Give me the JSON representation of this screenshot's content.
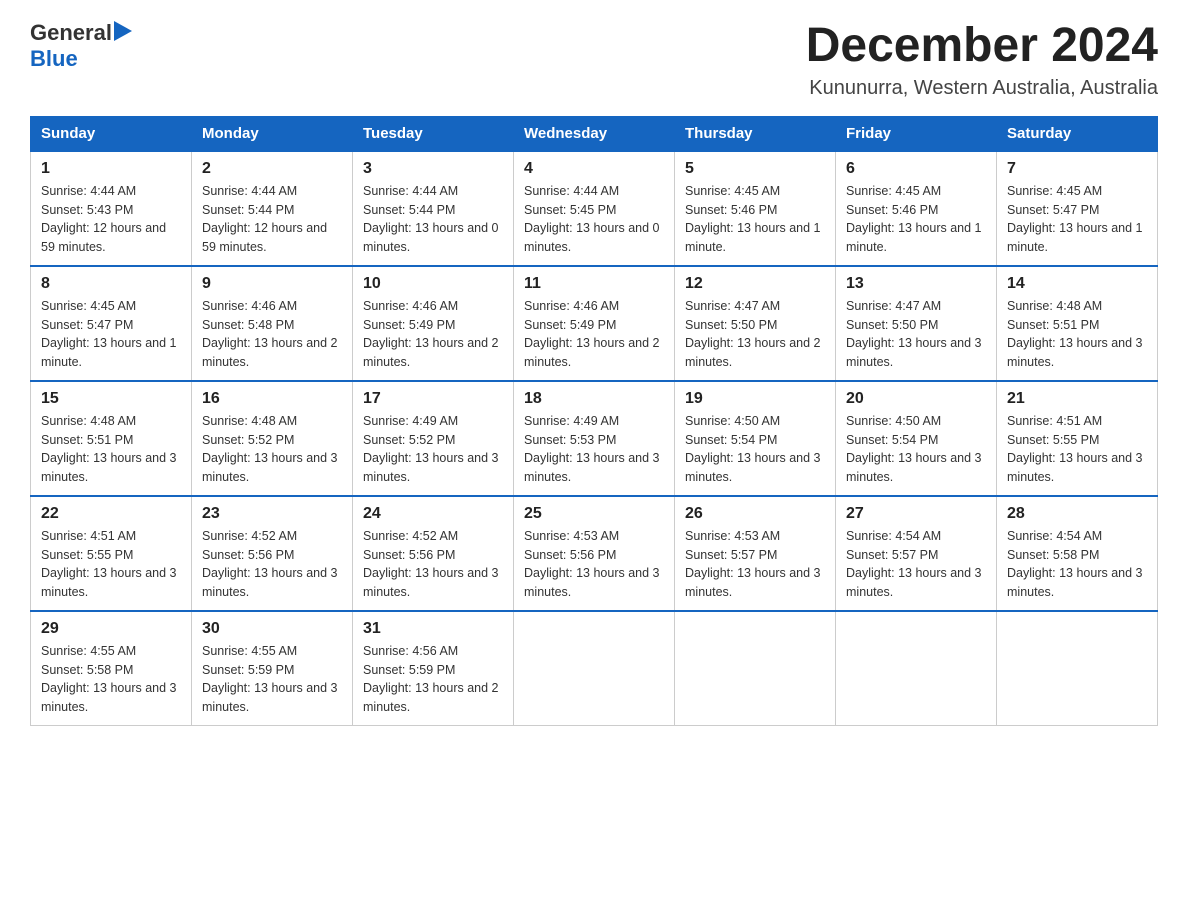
{
  "header": {
    "logo_general": "General",
    "logo_blue": "Blue",
    "month_title": "December 2024",
    "location": "Kununurra, Western Australia, Australia"
  },
  "days_of_week": [
    "Sunday",
    "Monday",
    "Tuesday",
    "Wednesday",
    "Thursday",
    "Friday",
    "Saturday"
  ],
  "weeks": [
    [
      {
        "day": "1",
        "sunrise": "4:44 AM",
        "sunset": "5:43 PM",
        "daylight": "12 hours and 59 minutes."
      },
      {
        "day": "2",
        "sunrise": "4:44 AM",
        "sunset": "5:44 PM",
        "daylight": "12 hours and 59 minutes."
      },
      {
        "day": "3",
        "sunrise": "4:44 AM",
        "sunset": "5:44 PM",
        "daylight": "13 hours and 0 minutes."
      },
      {
        "day": "4",
        "sunrise": "4:44 AM",
        "sunset": "5:45 PM",
        "daylight": "13 hours and 0 minutes."
      },
      {
        "day": "5",
        "sunrise": "4:45 AM",
        "sunset": "5:46 PM",
        "daylight": "13 hours and 1 minute."
      },
      {
        "day": "6",
        "sunrise": "4:45 AM",
        "sunset": "5:46 PM",
        "daylight": "13 hours and 1 minute."
      },
      {
        "day": "7",
        "sunrise": "4:45 AM",
        "sunset": "5:47 PM",
        "daylight": "13 hours and 1 minute."
      }
    ],
    [
      {
        "day": "8",
        "sunrise": "4:45 AM",
        "sunset": "5:47 PM",
        "daylight": "13 hours and 1 minute."
      },
      {
        "day": "9",
        "sunrise": "4:46 AM",
        "sunset": "5:48 PM",
        "daylight": "13 hours and 2 minutes."
      },
      {
        "day": "10",
        "sunrise": "4:46 AM",
        "sunset": "5:49 PM",
        "daylight": "13 hours and 2 minutes."
      },
      {
        "day": "11",
        "sunrise": "4:46 AM",
        "sunset": "5:49 PM",
        "daylight": "13 hours and 2 minutes."
      },
      {
        "day": "12",
        "sunrise": "4:47 AM",
        "sunset": "5:50 PM",
        "daylight": "13 hours and 2 minutes."
      },
      {
        "day": "13",
        "sunrise": "4:47 AM",
        "sunset": "5:50 PM",
        "daylight": "13 hours and 3 minutes."
      },
      {
        "day": "14",
        "sunrise": "4:48 AM",
        "sunset": "5:51 PM",
        "daylight": "13 hours and 3 minutes."
      }
    ],
    [
      {
        "day": "15",
        "sunrise": "4:48 AM",
        "sunset": "5:51 PM",
        "daylight": "13 hours and 3 minutes."
      },
      {
        "day": "16",
        "sunrise": "4:48 AM",
        "sunset": "5:52 PM",
        "daylight": "13 hours and 3 minutes."
      },
      {
        "day": "17",
        "sunrise": "4:49 AM",
        "sunset": "5:52 PM",
        "daylight": "13 hours and 3 minutes."
      },
      {
        "day": "18",
        "sunrise": "4:49 AM",
        "sunset": "5:53 PM",
        "daylight": "13 hours and 3 minutes."
      },
      {
        "day": "19",
        "sunrise": "4:50 AM",
        "sunset": "5:54 PM",
        "daylight": "13 hours and 3 minutes."
      },
      {
        "day": "20",
        "sunrise": "4:50 AM",
        "sunset": "5:54 PM",
        "daylight": "13 hours and 3 minutes."
      },
      {
        "day": "21",
        "sunrise": "4:51 AM",
        "sunset": "5:55 PM",
        "daylight": "13 hours and 3 minutes."
      }
    ],
    [
      {
        "day": "22",
        "sunrise": "4:51 AM",
        "sunset": "5:55 PM",
        "daylight": "13 hours and 3 minutes."
      },
      {
        "day": "23",
        "sunrise": "4:52 AM",
        "sunset": "5:56 PM",
        "daylight": "13 hours and 3 minutes."
      },
      {
        "day": "24",
        "sunrise": "4:52 AM",
        "sunset": "5:56 PM",
        "daylight": "13 hours and 3 minutes."
      },
      {
        "day": "25",
        "sunrise": "4:53 AM",
        "sunset": "5:56 PM",
        "daylight": "13 hours and 3 minutes."
      },
      {
        "day": "26",
        "sunrise": "4:53 AM",
        "sunset": "5:57 PM",
        "daylight": "13 hours and 3 minutes."
      },
      {
        "day": "27",
        "sunrise": "4:54 AM",
        "sunset": "5:57 PM",
        "daylight": "13 hours and 3 minutes."
      },
      {
        "day": "28",
        "sunrise": "4:54 AM",
        "sunset": "5:58 PM",
        "daylight": "13 hours and 3 minutes."
      }
    ],
    [
      {
        "day": "29",
        "sunrise": "4:55 AM",
        "sunset": "5:58 PM",
        "daylight": "13 hours and 3 minutes."
      },
      {
        "day": "30",
        "sunrise": "4:55 AM",
        "sunset": "5:59 PM",
        "daylight": "13 hours and 3 minutes."
      },
      {
        "day": "31",
        "sunrise": "4:56 AM",
        "sunset": "5:59 PM",
        "daylight": "13 hours and 2 minutes."
      },
      null,
      null,
      null,
      null
    ]
  ]
}
